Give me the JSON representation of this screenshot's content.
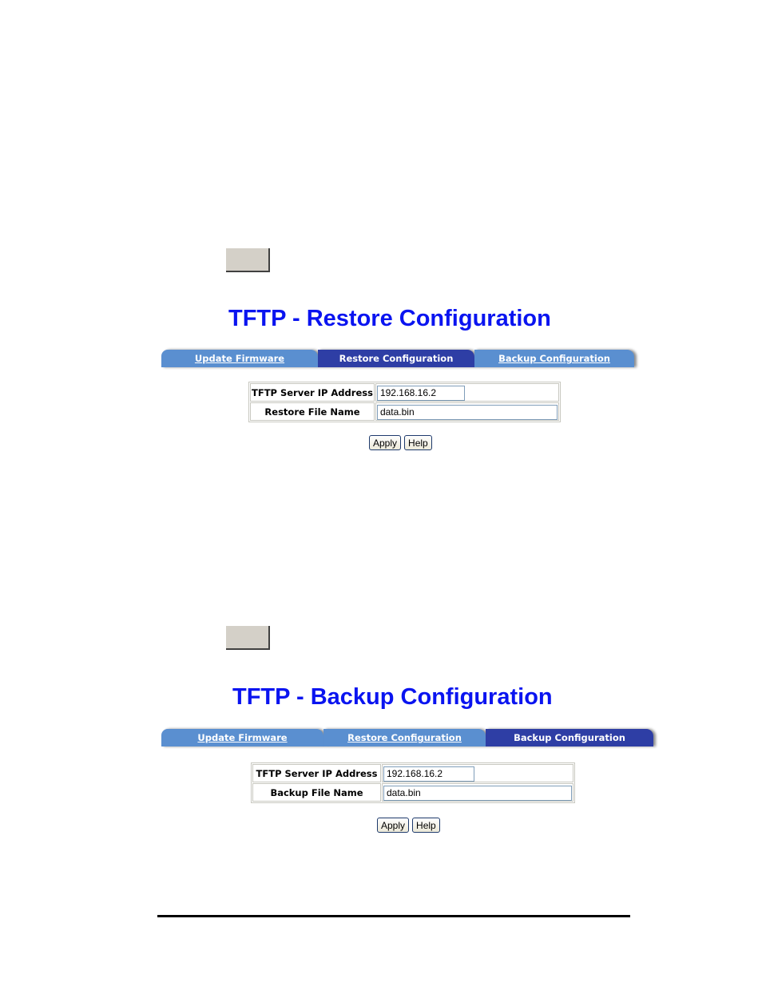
{
  "sections": [
    {
      "title": "TFTP - Restore Configuration",
      "tabs": [
        {
          "label": "Update Firmware",
          "active": false
        },
        {
          "label": "Restore Configuration",
          "active": true
        },
        {
          "label": "Backup Configuration",
          "active": false
        }
      ],
      "fields": [
        {
          "label": "TFTP Server IP Address",
          "value": "192.168.16.2"
        },
        {
          "label": "Restore File Name",
          "value": "data.bin"
        }
      ],
      "buttons": {
        "apply": "Apply",
        "help": "Help"
      }
    },
    {
      "title": "TFTP - Backup Configuration",
      "tabs": [
        {
          "label": "Update Firmware",
          "active": false
        },
        {
          "label": "Restore Configuration",
          "active": false
        },
        {
          "label": "Backup Configuration",
          "active": true
        }
      ],
      "fields": [
        {
          "label": "TFTP Server IP Address",
          "value": "192.168.16.2"
        },
        {
          "label": "Backup File Name",
          "value": "data.bin"
        }
      ],
      "buttons": {
        "apply": "Apply",
        "help": "Help"
      }
    }
  ],
  "colors": {
    "title": "#0a14f0",
    "tab_inactive": "#5a8fd0",
    "tab_active": "#2e3ea5",
    "button_face": "#d4d0c8"
  }
}
